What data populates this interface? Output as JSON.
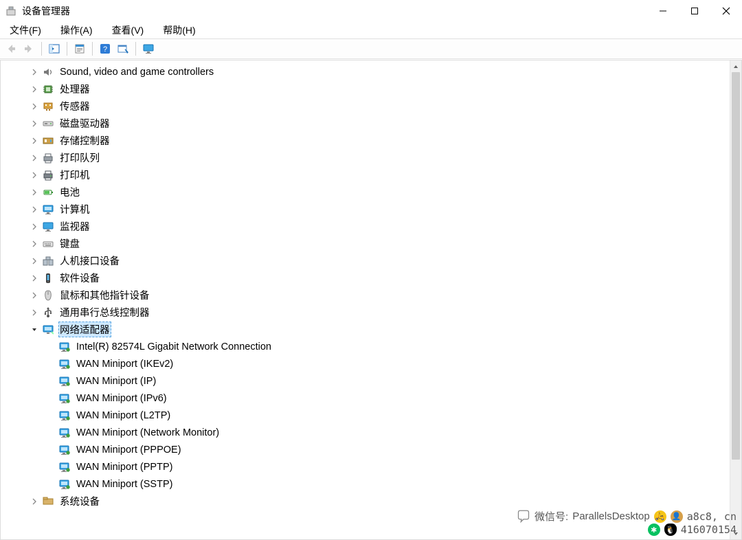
{
  "titlebar": {
    "title": "设备管理器"
  },
  "menubar": {
    "items": [
      {
        "label": "文件(F)"
      },
      {
        "label": "操作(A)"
      },
      {
        "label": "查看(V)"
      },
      {
        "label": "帮助(H)"
      }
    ]
  },
  "toolbar": {
    "buttons": [
      {
        "name": "nav-back-button",
        "icon": "arrow-left",
        "disabled": true
      },
      {
        "name": "nav-forward-button",
        "icon": "arrow-right",
        "disabled": true
      },
      {
        "sep": true
      },
      {
        "name": "show-hide-tree-button",
        "icon": "panel-toggle"
      },
      {
        "sep": true
      },
      {
        "name": "properties-button",
        "icon": "properties"
      },
      {
        "sep": true
      },
      {
        "name": "help-button",
        "icon": "help"
      },
      {
        "name": "scan-hardware-button",
        "icon": "scan"
      },
      {
        "sep": true
      },
      {
        "name": "monitor-devices-button",
        "icon": "monitor"
      }
    ]
  },
  "tree": {
    "rows": [
      {
        "depth": 1,
        "expandable": true,
        "expanded": false,
        "icon": "sound",
        "label": "Sound, video and game controllers"
      },
      {
        "depth": 1,
        "expandable": true,
        "expanded": false,
        "icon": "cpu",
        "label": "处理器"
      },
      {
        "depth": 1,
        "expandable": true,
        "expanded": false,
        "icon": "sensor",
        "label": "传感器"
      },
      {
        "depth": 1,
        "expandable": true,
        "expanded": false,
        "icon": "disk",
        "label": "磁盘驱动器"
      },
      {
        "depth": 1,
        "expandable": true,
        "expanded": false,
        "icon": "storagectl",
        "label": "存储控制器"
      },
      {
        "depth": 1,
        "expandable": true,
        "expanded": false,
        "icon": "printqueue",
        "label": "打印队列"
      },
      {
        "depth": 1,
        "expandable": true,
        "expanded": false,
        "icon": "printer",
        "label": "打印机"
      },
      {
        "depth": 1,
        "expandable": true,
        "expanded": false,
        "icon": "battery",
        "label": "电池"
      },
      {
        "depth": 1,
        "expandable": true,
        "expanded": false,
        "icon": "computer",
        "label": "计算机"
      },
      {
        "depth": 1,
        "expandable": true,
        "expanded": false,
        "icon": "monitor",
        "label": "监视器"
      },
      {
        "depth": 1,
        "expandable": true,
        "expanded": false,
        "icon": "keyboard",
        "label": "键盘"
      },
      {
        "depth": 1,
        "expandable": true,
        "expanded": false,
        "icon": "hid",
        "label": "人机接口设备"
      },
      {
        "depth": 1,
        "expandable": true,
        "expanded": false,
        "icon": "software",
        "label": "软件设备"
      },
      {
        "depth": 1,
        "expandable": true,
        "expanded": false,
        "icon": "mouse",
        "label": "鼠标和其他指针设备"
      },
      {
        "depth": 1,
        "expandable": true,
        "expanded": false,
        "icon": "usb",
        "label": "通用串行总线控制器"
      },
      {
        "depth": 1,
        "expandable": true,
        "expanded": true,
        "icon": "network-category",
        "label": "网络适配器",
        "selected": true
      },
      {
        "depth": 2,
        "expandable": false,
        "icon": "nic",
        "label": "Intel(R) 82574L Gigabit Network Connection"
      },
      {
        "depth": 2,
        "expandable": false,
        "icon": "nic",
        "label": "WAN Miniport (IKEv2)"
      },
      {
        "depth": 2,
        "expandable": false,
        "icon": "nic",
        "label": "WAN Miniport (IP)"
      },
      {
        "depth": 2,
        "expandable": false,
        "icon": "nic",
        "label": "WAN Miniport (IPv6)"
      },
      {
        "depth": 2,
        "expandable": false,
        "icon": "nic",
        "label": "WAN Miniport (L2TP)"
      },
      {
        "depth": 2,
        "expandable": false,
        "icon": "nic",
        "label": "WAN Miniport (Network Monitor)"
      },
      {
        "depth": 2,
        "expandable": false,
        "icon": "nic",
        "label": "WAN Miniport (PPPOE)"
      },
      {
        "depth": 2,
        "expandable": false,
        "icon": "nic",
        "label": "WAN Miniport (PPTP)"
      },
      {
        "depth": 2,
        "expandable": false,
        "icon": "nic",
        "label": "WAN Miniport (SSTP)"
      },
      {
        "depth": 1,
        "expandable": true,
        "expanded": false,
        "icon": "system",
        "label": "系统设备"
      }
    ]
  },
  "watermark": {
    "line1_prefix": "微信号:",
    "line1_value": "ParallelsDesktop",
    "line1_suffix": "a8c8, cn",
    "line2_value": "416070154"
  }
}
